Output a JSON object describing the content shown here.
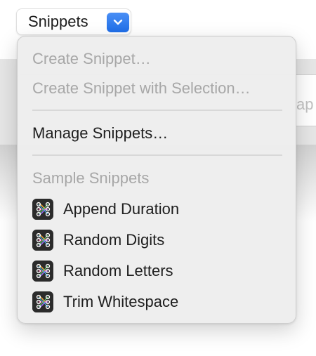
{
  "popup": {
    "label": "Snippets"
  },
  "background": {
    "field_text": "ap"
  },
  "menu": {
    "actions": [
      {
        "label": "Create Snippet…",
        "enabled": false
      },
      {
        "label": "Create Snippet with Selection…",
        "enabled": false
      }
    ],
    "manage": {
      "label": "Manage Snippets…",
      "enabled": true
    },
    "section_header": "Sample Snippets",
    "snippets": [
      {
        "label": "Append Duration",
        "icon": "snippet-icon"
      },
      {
        "label": "Random Digits",
        "icon": "snippet-icon"
      },
      {
        "label": "Random Letters",
        "icon": "snippet-icon"
      },
      {
        "label": "Trim Whitespace",
        "icon": "snippet-icon"
      }
    ]
  },
  "colors": {
    "accent": "#1f6ee8",
    "menu_background": "#eeeeee",
    "disabled_text": "#a7a7a7",
    "enabled_text": "#1e1e1e"
  }
}
